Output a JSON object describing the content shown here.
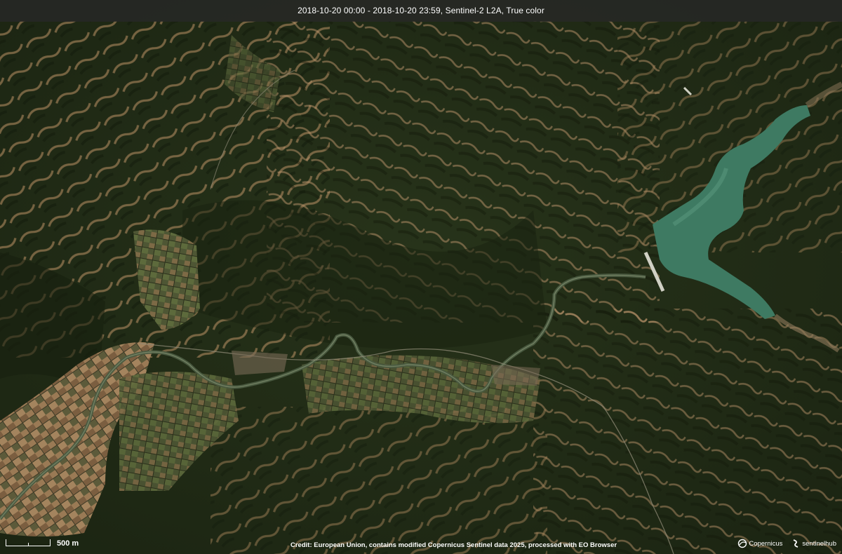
{
  "header": {
    "title": "2018-10-20 00:00 - 2018-10-20 23:59, Sentinel-2 L2A, True color"
  },
  "scale_bar": {
    "label": "500 m"
  },
  "footer": {
    "credit": "Credit: European Union, contains modified Copernicus Sentinel data 2025, processed with EO Browser"
  },
  "logos": {
    "copernicus": "Copernicus",
    "sentinelhub": "sentinelhub"
  },
  "colors": {
    "forest_dark": "#1f2a14",
    "forest_mid": "#2c3a1c",
    "bare_slope": "#b08b5e",
    "field_tan": "#8a6a48",
    "lake_green": "#3e7a62",
    "river_green": "#4a5a40"
  }
}
